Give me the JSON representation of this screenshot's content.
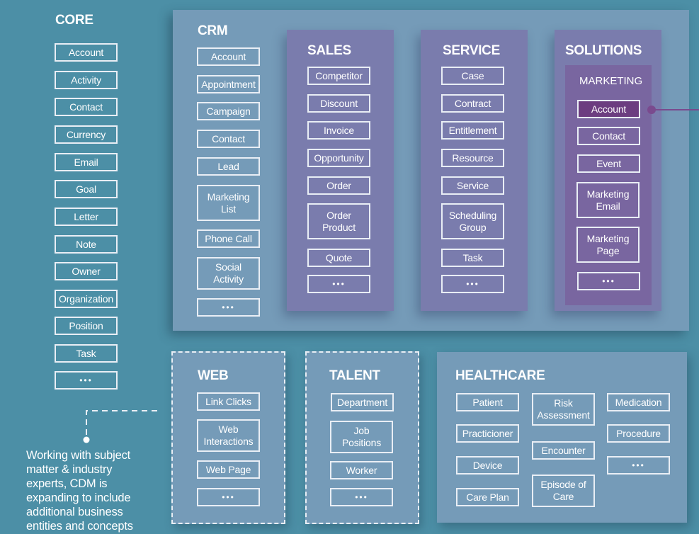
{
  "core": {
    "title": "CORE",
    "items": [
      "Account",
      "Activity",
      "Contact",
      "Currency",
      "Email",
      "Goal",
      "Letter",
      "Note",
      "Owner",
      "Organization",
      "Position",
      "Task",
      "•••"
    ]
  },
  "crm": {
    "title": "CRM",
    "items": [
      "Account",
      "Appointment",
      "Campaign",
      "Contact",
      "Lead",
      "Marketing\nList",
      "Phone Call",
      "Social\nActivity",
      "•••"
    ],
    "sales": {
      "title": "SALES",
      "items": [
        "Competitor",
        "Discount",
        "Invoice",
        "Opportunity",
        "Order",
        "Order\nProduct",
        "Quote",
        "•••"
      ]
    },
    "service": {
      "title": "SERVICE",
      "items": [
        "Case",
        "Contract",
        "Entitlement",
        "Resource",
        "Service",
        "Scheduling\nGroup",
        "Task",
        "•••"
      ]
    },
    "solutions": {
      "title": "SOLUTIONS",
      "marketing": {
        "title": "MARKETING",
        "items": [
          "Account",
          "Contact",
          "Event",
          "Marketing\nEmail",
          "Marketing\nPage",
          "•••"
        ],
        "highlighted_item": "Account"
      }
    }
  },
  "web": {
    "title": "WEB",
    "items": [
      "Link Clicks",
      "Web\nInteractions",
      "Web Page",
      "•••"
    ]
  },
  "talent": {
    "title": "TALENT",
    "items": [
      "Department",
      "Job\nPositions",
      "Worker",
      "•••"
    ]
  },
  "healthcare": {
    "title": "HEALTHCARE",
    "items": [
      "Patient",
      "Practicioner",
      "Device",
      "Care Plan",
      "Risk\nAssessment",
      "Encounter",
      "Episode of\nCare",
      "Medication",
      "Procedure",
      "•••"
    ]
  },
  "note": {
    "text": "Working with subject matter & industry experts, CDM is expanding to include additional business entities and concepts"
  },
  "colors": {
    "background": "#4c8fa6",
    "panel": "#759bb8",
    "purple_panel": "#7a7cad",
    "marketing_panel": "#7966a0",
    "highlight": "#6c3d80",
    "connector": "#7a4a8e"
  }
}
